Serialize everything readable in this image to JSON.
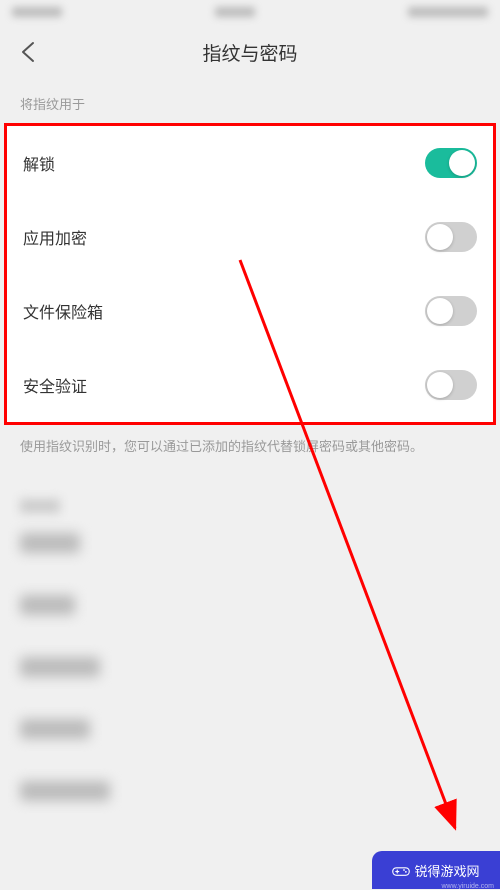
{
  "header": {
    "title": "指纹与密码"
  },
  "section": {
    "label": "将指纹用于"
  },
  "settings": [
    {
      "label": "解锁",
      "enabled": true
    },
    {
      "label": "应用加密",
      "enabled": false
    },
    {
      "label": "文件保险箱",
      "enabled": false
    },
    {
      "label": "安全验证",
      "enabled": false
    }
  ],
  "description": "使用指纹识别时，您可以通过已添加的指纹代替锁屏密码或其他密码。",
  "watermark": {
    "text": "锐得游戏网",
    "url": "www.yiruide.com"
  }
}
